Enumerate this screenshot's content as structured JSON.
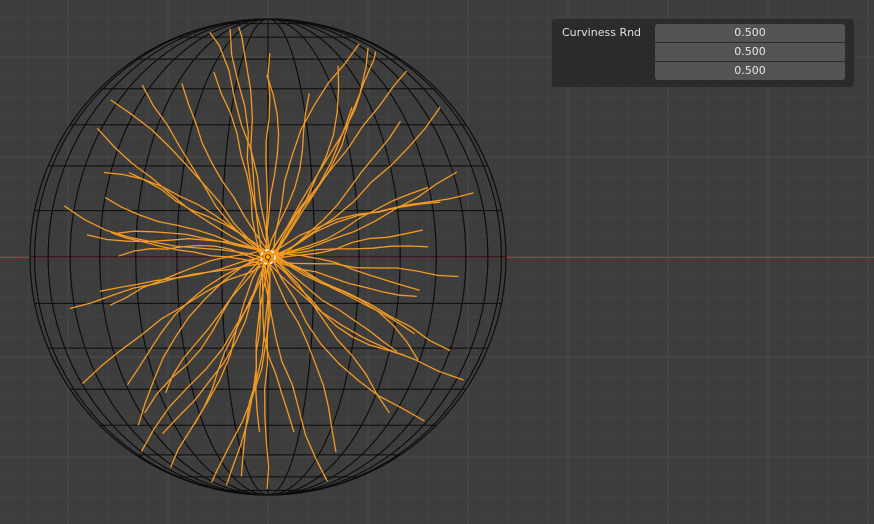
{
  "viewport": {
    "name": "3D Viewport",
    "background": "#3d3d3d",
    "grid_color": "#474747",
    "grid_minor_color": "#424242",
    "x_axis_color": "#a53a44",
    "wire_color": "#0d0d0d",
    "hair_color": "#f39a22"
  },
  "redo_panel": {
    "label": "Curviness Rnd",
    "values": [
      "0.500",
      "0.500",
      "0.500"
    ]
  }
}
